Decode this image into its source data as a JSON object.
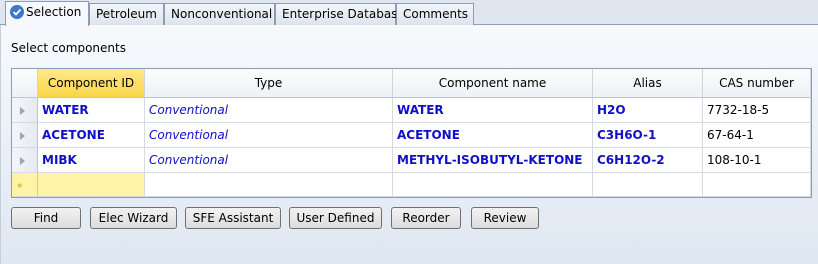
{
  "tabs": [
    {
      "label": "Selection",
      "active": true
    },
    {
      "label": "Petroleum"
    },
    {
      "label": "Nonconventional"
    },
    {
      "label": "Enterprise Database"
    },
    {
      "label": "Comments"
    }
  ],
  "section_label": "Select components",
  "grid": {
    "columns": [
      "Component ID",
      "Type",
      "Component name",
      "Alias",
      "CAS number"
    ],
    "rows": [
      {
        "id": "WATER",
        "type": "Conventional",
        "name": "WATER",
        "alias": "H2O",
        "cas": "7732-18-5"
      },
      {
        "id": "ACETONE",
        "type": "Conventional",
        "name": "ACETONE",
        "alias": "C3H6O-1",
        "cas": "67-64-1"
      },
      {
        "id": "MIBK",
        "type": "Conventional",
        "name": "METHYL-ISOBUTYL-KETONE",
        "alias": "C6H12O-2",
        "cas": "108-10-1"
      }
    ],
    "new_row_marker": "*"
  },
  "buttons": {
    "find": "Find",
    "elec_wizard": "Elec Wizard",
    "sfe_assistant": "SFE Assistant",
    "user_defined": "User Defined",
    "reorder": "Reorder",
    "review": "Review"
  },
  "colors": {
    "active_header": "#f9d648",
    "new_row": "#fff3a8",
    "data_text": "#1010c8"
  },
  "icons": {
    "selection_tab": "check-circle-icon",
    "row_header": "row-arrow-icon",
    "new_row": "star-icon"
  }
}
